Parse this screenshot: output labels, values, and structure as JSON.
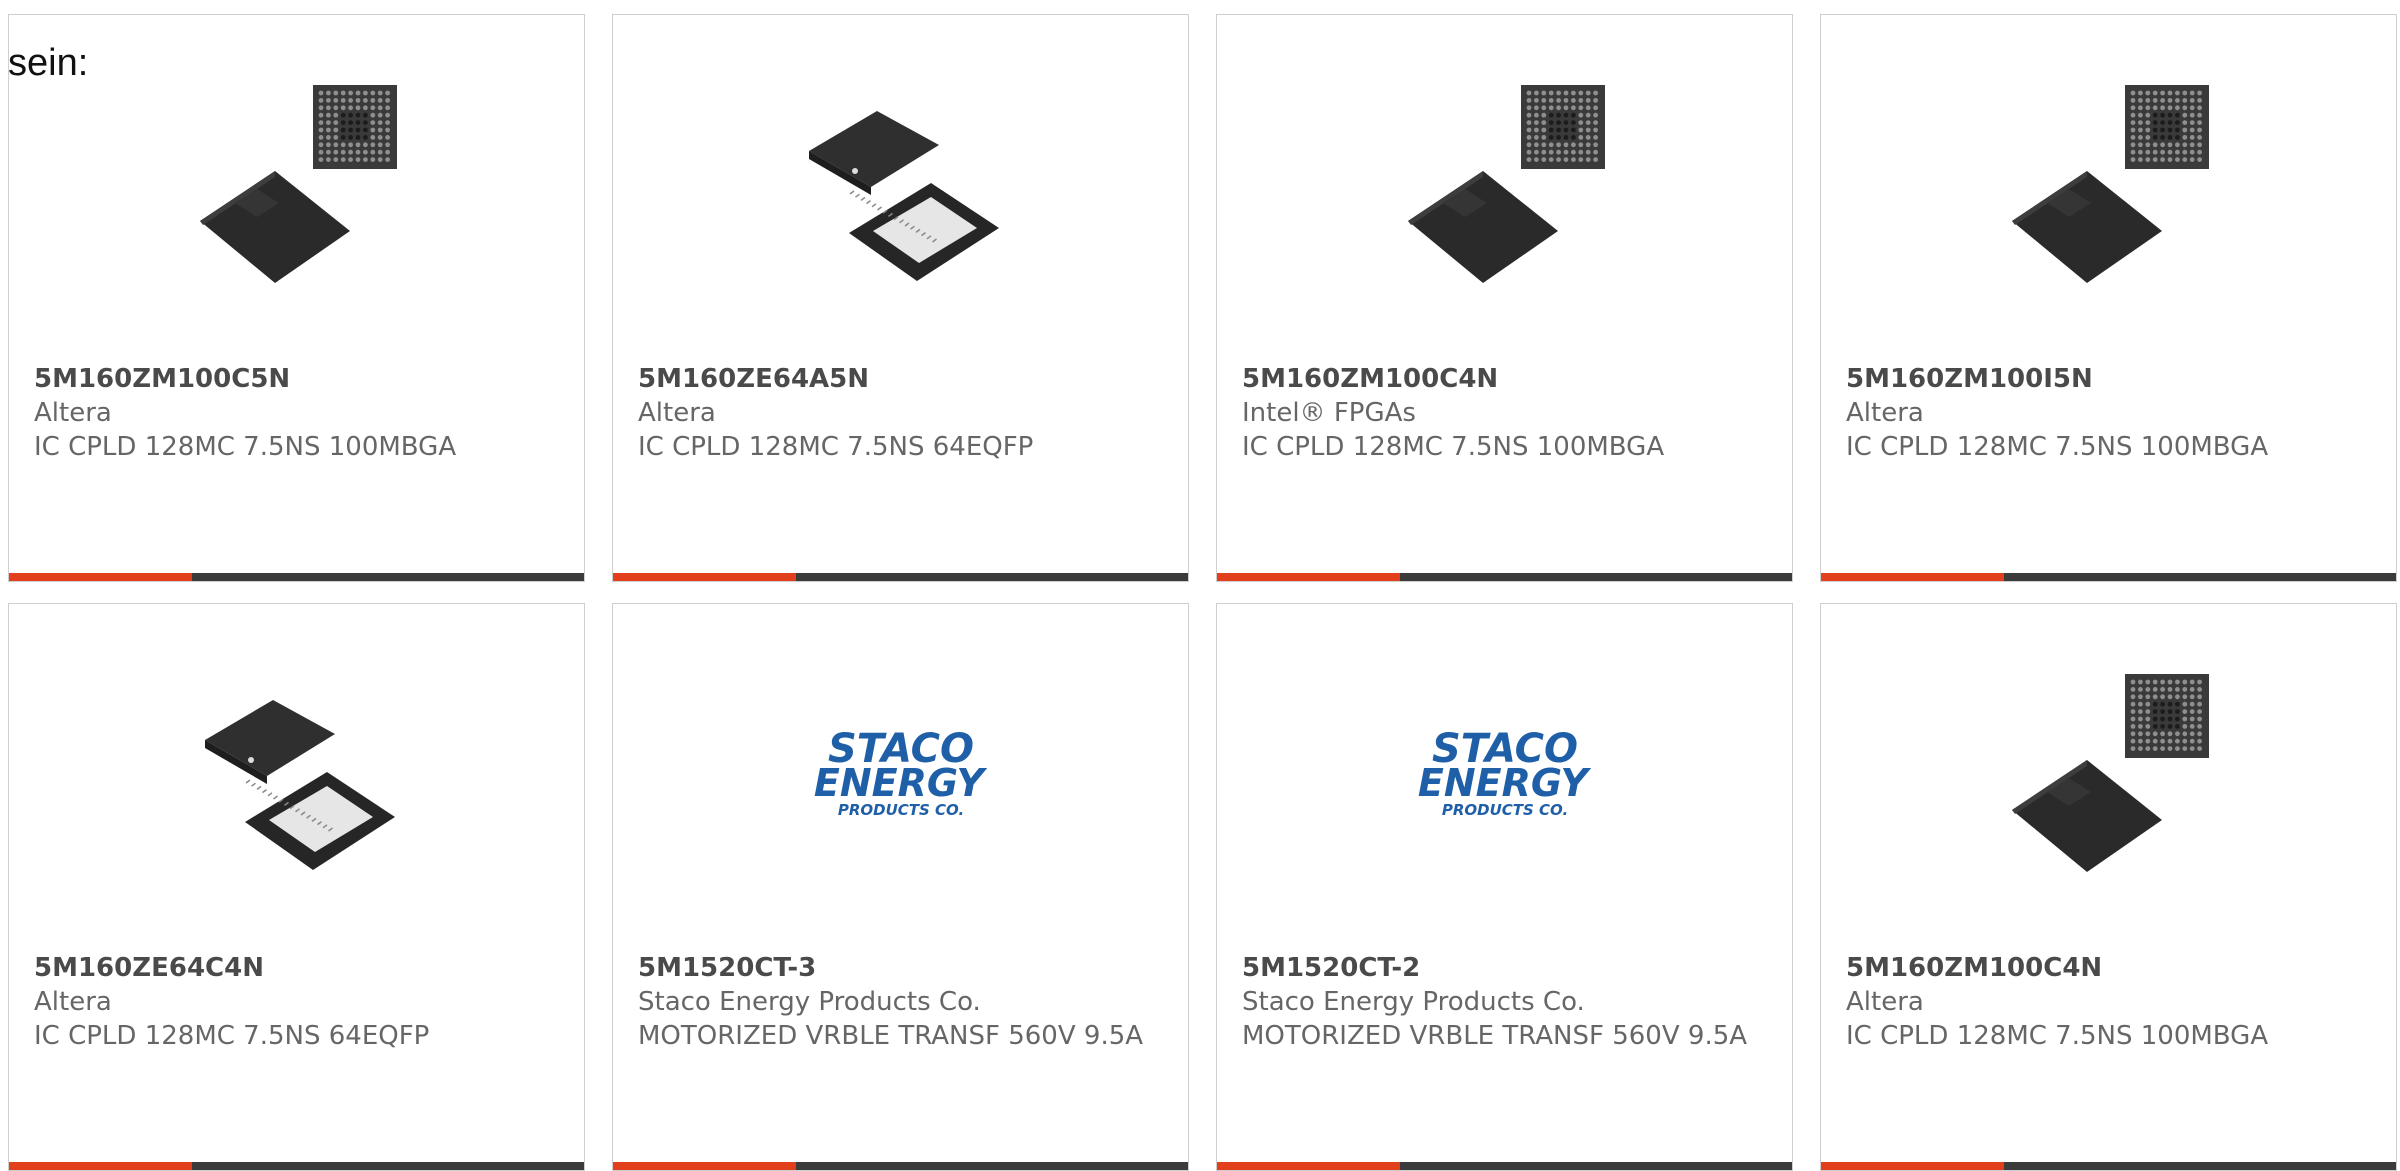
{
  "intro_text": "sein:",
  "colors": {
    "accent": "#e2401c",
    "bar": "#3b3b3b",
    "staco_blue": "#1f5fa8"
  },
  "products": [
    {
      "part_number": "5M160ZM100C5N",
      "manufacturer": "Altera",
      "description": "IC CPLD 128MC 7.5NS 100MBGA",
      "image": "bga-chip"
    },
    {
      "part_number": "5M160ZE64A5N",
      "manufacturer": "Altera",
      "description": "IC CPLD 128MC 7.5NS 64EQFP",
      "image": "qfp-chip"
    },
    {
      "part_number": "5M160ZM100C4N",
      "manufacturer": "Intel® FPGAs",
      "description": "IC CPLD 128MC 7.5NS 100MBGA",
      "image": "bga-chip"
    },
    {
      "part_number": "5M160ZM100I5N",
      "manufacturer": "Altera",
      "description": "IC CPLD 128MC 7.5NS 100MBGA",
      "image": "bga-chip"
    },
    {
      "part_number": "5M160ZE64C4N",
      "manufacturer": "Altera",
      "description": "IC CPLD 128MC 7.5NS 64EQFP",
      "image": "qfp-chip"
    },
    {
      "part_number": "5M1520CT-3",
      "manufacturer": "Staco Energy Products Co.",
      "description": "MOTORIZED VRBLE TRANSF 560V 9.5A",
      "image": "staco-logo"
    },
    {
      "part_number": "5M1520CT-2",
      "manufacturer": "Staco Energy Products Co.",
      "description": "MOTORIZED VRBLE TRANSF 560V 9.5A",
      "image": "staco-logo"
    },
    {
      "part_number": "5M160ZM100C4N",
      "manufacturer": "Altera",
      "description": "IC CPLD 128MC 7.5NS 100MBGA",
      "image": "bga-chip"
    }
  ],
  "logo": {
    "line1": "STACO",
    "line2": "ENERGY",
    "line3": "PRODUCTS CO."
  }
}
